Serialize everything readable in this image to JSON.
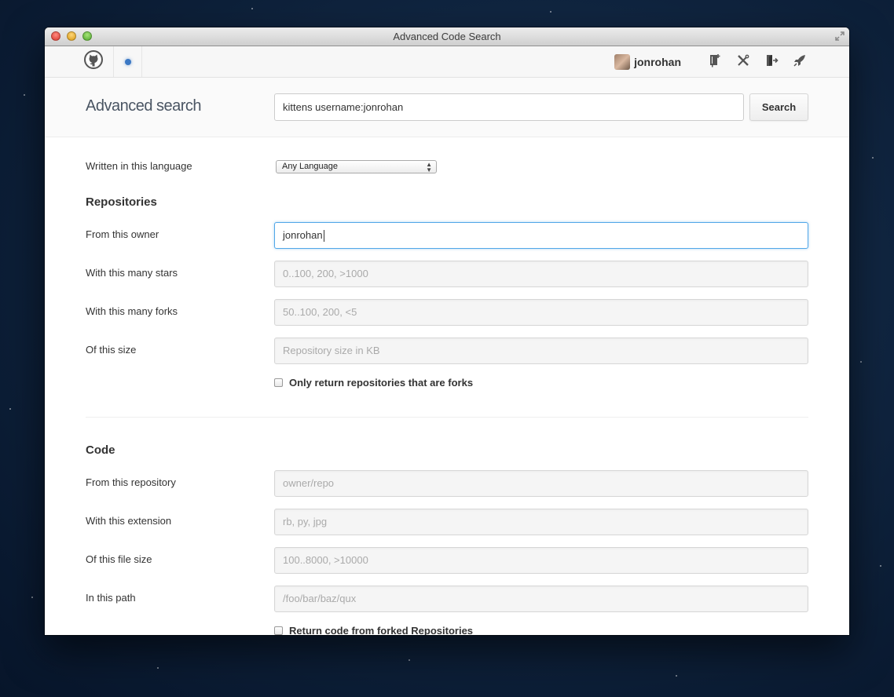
{
  "window": {
    "title": "Advanced Code Search"
  },
  "topnav": {
    "username": "jonrohan",
    "icons": [
      "github-octocat-icon",
      "notification-dot-icon",
      "new-repo-icon",
      "settings-tools-icon",
      "sign-out-icon",
      "rocket-icon"
    ]
  },
  "header": {
    "title": "Advanced search",
    "search_value": "kittens username:jonrohan",
    "search_button": "Search"
  },
  "language": {
    "label": "Written in this language",
    "selected": "Any Language"
  },
  "repositories": {
    "heading": "Repositories",
    "fields": [
      {
        "label": "From this owner",
        "value": "jonrohan",
        "placeholder": ""
      },
      {
        "label": "With this many stars",
        "value": "",
        "placeholder": "0..100, 200, >1000"
      },
      {
        "label": "With this many forks",
        "value": "",
        "placeholder": "50..100, 200, <5"
      },
      {
        "label": "Of this size",
        "value": "",
        "placeholder": "Repository size in KB"
      }
    ],
    "checkbox_label": "Only return repositories that are forks"
  },
  "code": {
    "heading": "Code",
    "fields": [
      {
        "label": "From this repository",
        "placeholder": "owner/repo"
      },
      {
        "label": "With this extension",
        "placeholder": "rb, py, jpg"
      },
      {
        "label": "Of this file size",
        "placeholder": "100..8000, >10000"
      },
      {
        "label": "In this path",
        "placeholder": "/foo/bar/baz/qux"
      }
    ],
    "checkbox_label": "Return code from forked Repositories"
  },
  "colors": {
    "focus_border": "#51a7e8",
    "title_text": "#4a5563",
    "notification_dot": "#3b78c4"
  }
}
